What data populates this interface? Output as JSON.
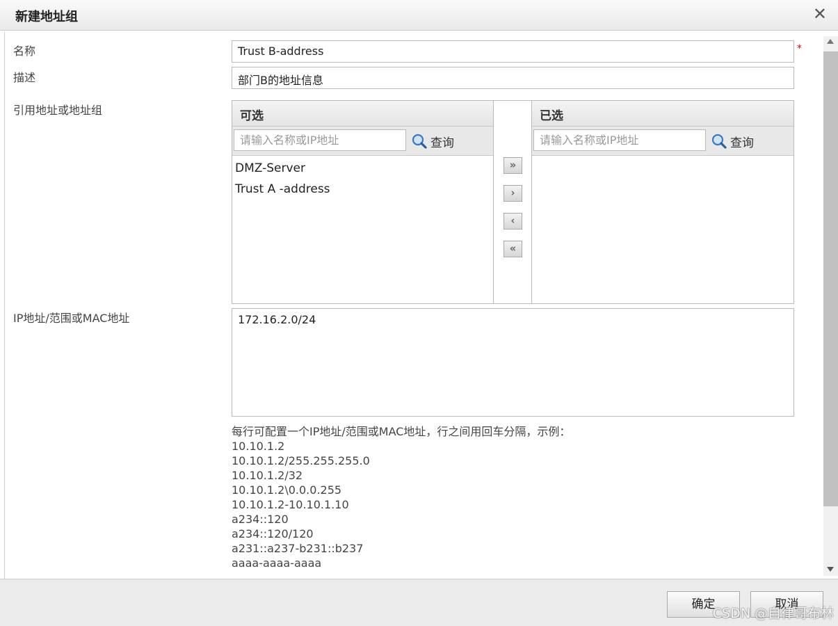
{
  "dialog": {
    "title": "新建地址组",
    "close_glyph": "✕"
  },
  "form": {
    "name_label": "名称",
    "name_value": "Trust B-address",
    "required_mark": "*",
    "desc_label": "描述",
    "desc_value": "部门B的地址信息",
    "ref_label": "引用地址或地址组",
    "ip_label": "IP地址/范围或MAC地址",
    "ip_value": "172.16.2.0/24"
  },
  "picker": {
    "available": {
      "header": "可选",
      "search_placeholder": "请输入名称或IP地址",
      "search_button": "查询",
      "items": [
        "DMZ-Server",
        "Trust A -address"
      ]
    },
    "selected": {
      "header": "已选",
      "search_placeholder": "请输入名称或IP地址",
      "search_button": "查询",
      "items": []
    },
    "move_buttons": {
      "add_all": "»",
      "add": "›",
      "remove": "‹",
      "remove_all": "«"
    }
  },
  "hint": {
    "lines": [
      "每行可配置一个IP地址/范围或MAC地址，行之间用回车分隔，示例：",
      "10.10.1.2",
      "10.10.1.2/255.255.255.0",
      "10.10.1.2/32",
      "10.10.1.2\\0.0.0.255",
      "10.10.1.2-10.10.1.10",
      "a234::120",
      "a234::120/120",
      "a231::a237-b231::b237",
      "aaaa-aaaa-aaaa"
    ]
  },
  "footer": {
    "ok_label": "确定",
    "cancel_label": "取消"
  },
  "watermark": "CSDN @自律哥布林",
  "colors": {
    "required": "#e00000",
    "border": "#b9b9b9",
    "header_bg": "#e8e8e8"
  }
}
